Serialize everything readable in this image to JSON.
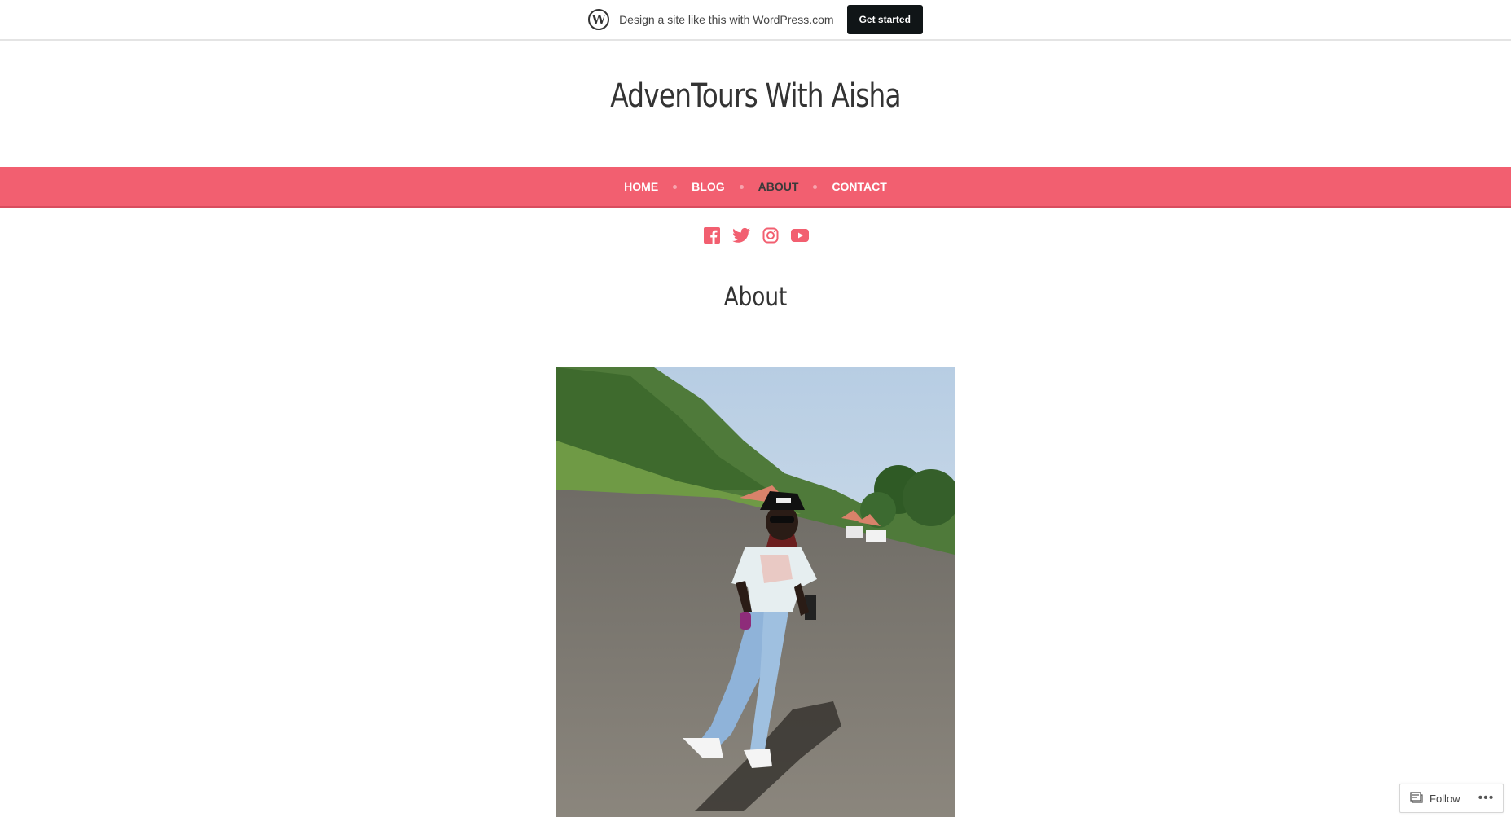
{
  "promo": {
    "text": "Design a site like this with WordPress.com",
    "button_label": "Get started"
  },
  "site": {
    "title": "AdvenTours With Aisha"
  },
  "nav": {
    "items": [
      {
        "label": "HOME",
        "current": false
      },
      {
        "label": "BLOG",
        "current": false
      },
      {
        "label": "ABOUT",
        "current": true
      },
      {
        "label": "CONTACT",
        "current": false
      }
    ]
  },
  "social": {
    "icons": [
      "facebook-icon",
      "twitter-icon",
      "instagram-icon",
      "youtube-icon"
    ],
    "color": "#f25f70"
  },
  "page": {
    "heading": "About"
  },
  "follow": {
    "label": "Follow",
    "more": "•••"
  },
  "colors": {
    "accent": "#f25f70",
    "promo_button_bg": "#101517"
  }
}
